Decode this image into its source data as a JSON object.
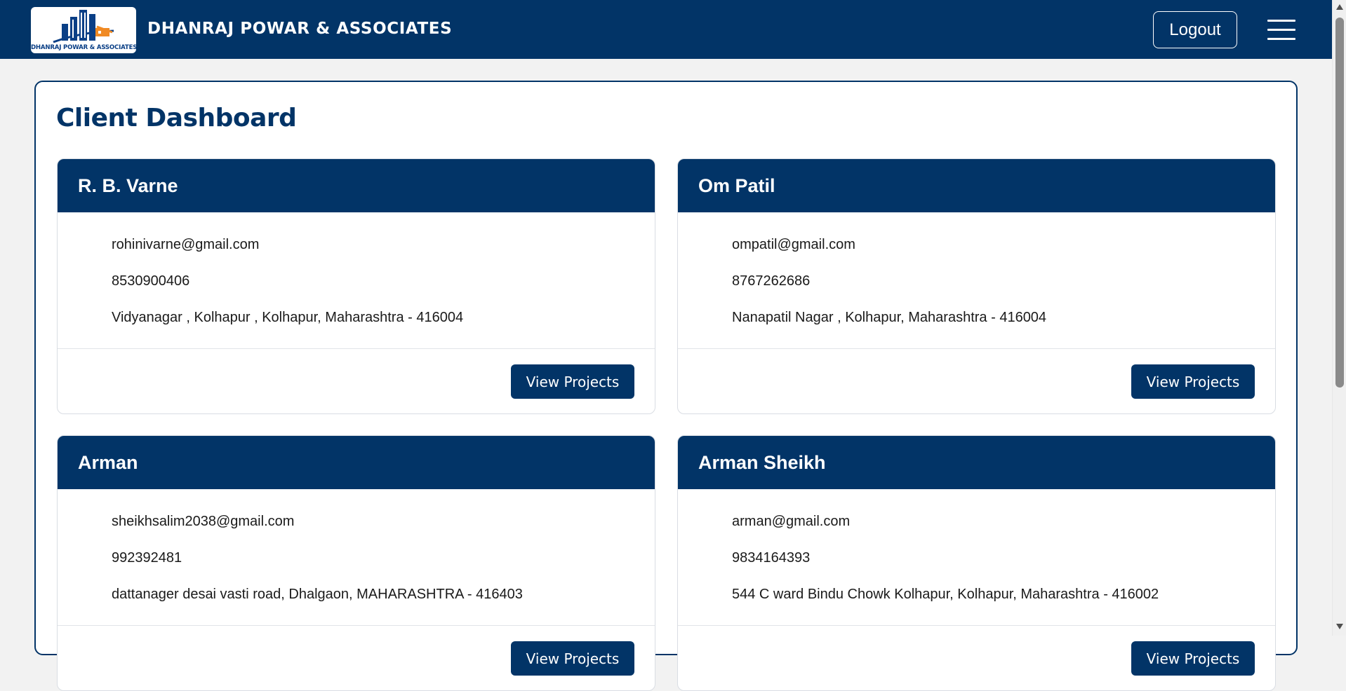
{
  "header": {
    "logo_caption": "DHANRAJ POWAR & ASSOCIATES",
    "brand": "DHANRAJ POWAR & ASSOCIATES",
    "logout_label": "Logout",
    "menu_icon": "hamburger-menu-icon"
  },
  "page": {
    "title": "Client Dashboard"
  },
  "clients": [
    {
      "name": "R. B. Varne",
      "email": "rohinivarne@gmail.com",
      "phone": "8530900406",
      "address": "Vidyanagar , Kolhapur , Kolhapur, Maharashtra - 416004",
      "button_label": "View Projects"
    },
    {
      "name": "Om Patil",
      "email": "ompatil@gmail.com",
      "phone": "8767262686",
      "address": "Nanapatil Nagar , Kolhapur, Maharashtra - 416004",
      "button_label": "View Projects"
    },
    {
      "name": "Arman",
      "email": "sheikhsalim2038@gmail.com",
      "phone": "992392481",
      "address": "dattanager desai vasti road, Dhalgaon, MAHARASHTRA - 416403",
      "button_label": "View Projects"
    },
    {
      "name": "Arman Sheikh",
      "email": "arman@gmail.com",
      "phone": "9834164393",
      "address": "544 C ward Bindu Chowk Kolhapur, Kolhapur, Maharashtra - 416002",
      "button_label": "View Projects"
    }
  ],
  "colors": {
    "primary": "#023467",
    "accent": "#f08a24",
    "background": "#f2f2f2",
    "card_background": "#ffffff"
  }
}
